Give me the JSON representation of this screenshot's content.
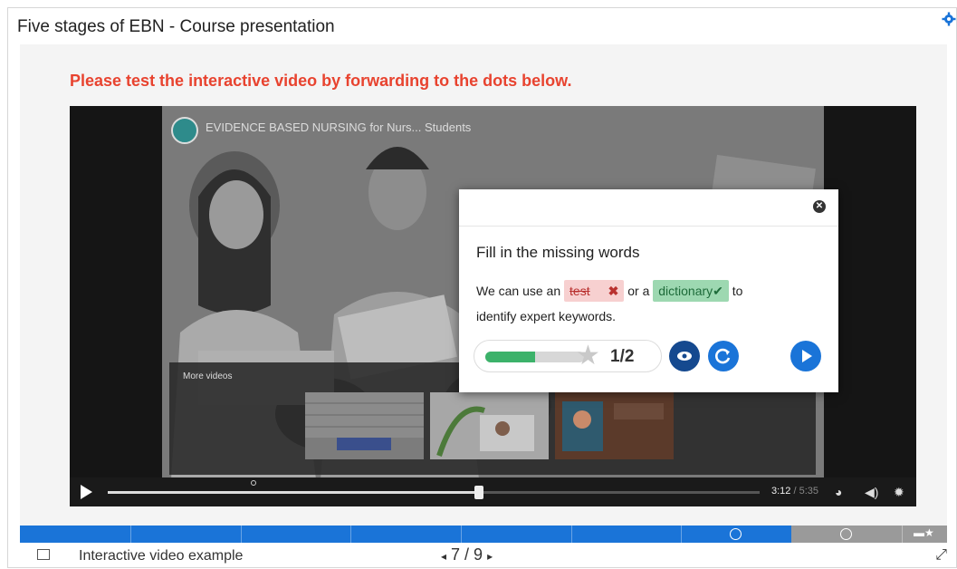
{
  "page": {
    "title": "Five stages of EBN - Course presentation"
  },
  "slide": {
    "instruction": "Please test the interactive video by forwarding to the dots below."
  },
  "video": {
    "channel_title": "EVIDENCE BASED NURSING for Nurs... Students",
    "more_videos_label": "More videos",
    "more_videos_close": "×",
    "time_current": "3:12",
    "time_duration": "/ 5:35",
    "progress_fraction": 0.57
  },
  "dialog": {
    "close_symbol": "✕",
    "heading": "Fill in the missing words",
    "sentence_start": "We can use an",
    "wrong_answer": "test",
    "wrong_mark": "✖",
    "middle": "or a",
    "correct_answer": "dictionary",
    "correct_mark": "✔",
    "end_inline": "to",
    "sentence_end": "identify expert keywords.",
    "score": "1/2",
    "score_fraction": 0.5
  },
  "footer": {
    "label": "Interactive video example",
    "pager": "7 / 9",
    "prev_arrow": "◂",
    "next_arrow": "▸"
  },
  "icons": {
    "gear": "gear-icon",
    "eye": "eye-icon",
    "retry": "retry-icon",
    "play": "play-icon",
    "fullscreen": "fullscreen-icon"
  },
  "colors": {
    "accent_blue": "#1a74d8",
    "instruction_red": "#e8432f",
    "wrong_bg": "#f7d0d0",
    "correct_bg": "#9dd8b1",
    "score_green": "#3cb26a",
    "dark_blue_btn": "#15498f"
  }
}
